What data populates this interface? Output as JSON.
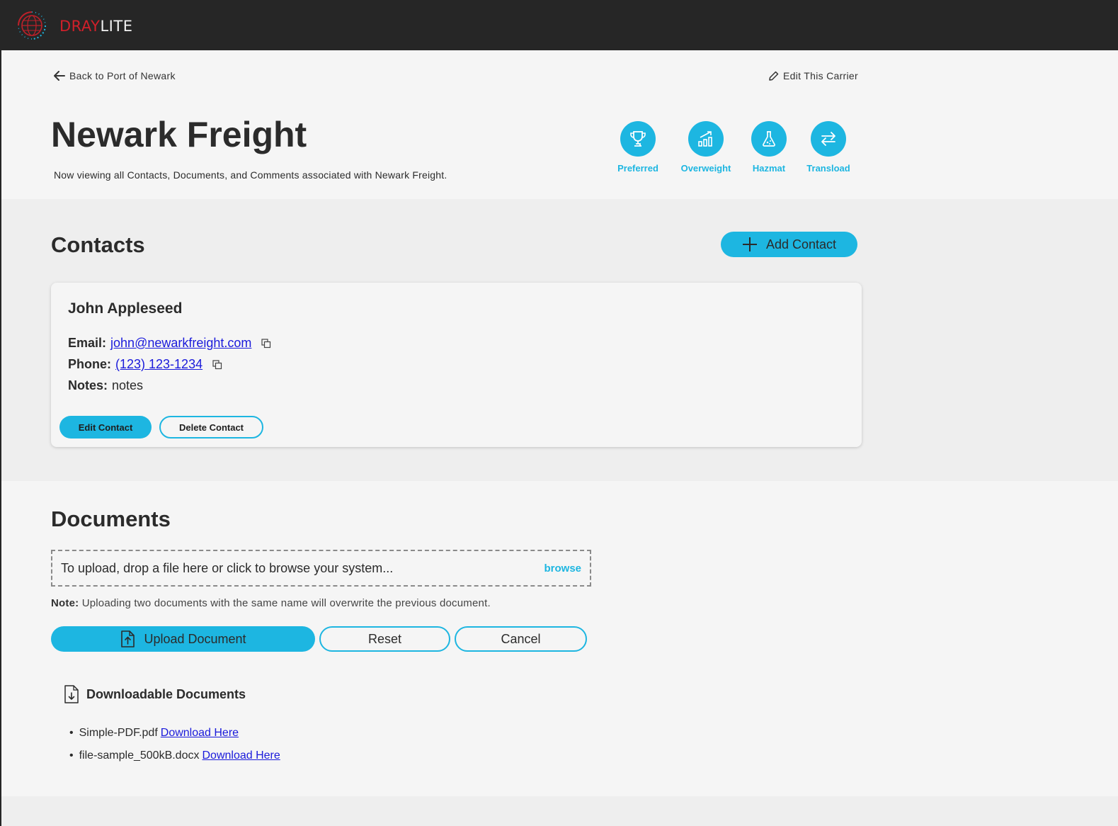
{
  "brand": {
    "part1": "DRAY",
    "part2": "LITE",
    "red": "#d0202a",
    "accent": "#1db6e1"
  },
  "header": {
    "back_label": "Back to Port of Newark",
    "edit_label": "Edit This Carrier",
    "title": "Newark Freight",
    "subtitle": "Now viewing all Contacts, Documents, and Comments associated with Newark Freight.",
    "badges": [
      {
        "label": "Preferred",
        "icon": "trophy-icon"
      },
      {
        "label": "Overweight",
        "icon": "chart-up-icon"
      },
      {
        "label": "Hazmat",
        "icon": "flask-icon"
      },
      {
        "label": "Transload",
        "icon": "swap-arrows-icon"
      }
    ]
  },
  "contacts": {
    "title": "Contacts",
    "add_label": "Add Contact",
    "items": [
      {
        "name": "John Appleseed",
        "email_label": "Email:",
        "email": "john@newarkfreight.com",
        "phone_label": "Phone:",
        "phone": "(123) 123-1234",
        "notes_label": "Notes:",
        "notes": "notes",
        "edit_label": "Edit Contact",
        "delete_label": "Delete Contact"
      }
    ]
  },
  "documents": {
    "title": "Documents",
    "dropzone_text": "To upload, drop a file here or click to browse your system...",
    "browse_label": "browse",
    "note_label": "Note:",
    "note_text": "Uploading two documents with the same name will overwrite the previous document.",
    "upload_label": "Upload Document",
    "reset_label": "Reset",
    "cancel_label": "Cancel",
    "downloadable_title": "Downloadable Documents",
    "files": [
      {
        "name": "Simple-PDF.pdf",
        "link": "Download Here"
      },
      {
        "name": "file-sample_500kB.docx",
        "link": "Download Here"
      }
    ]
  }
}
